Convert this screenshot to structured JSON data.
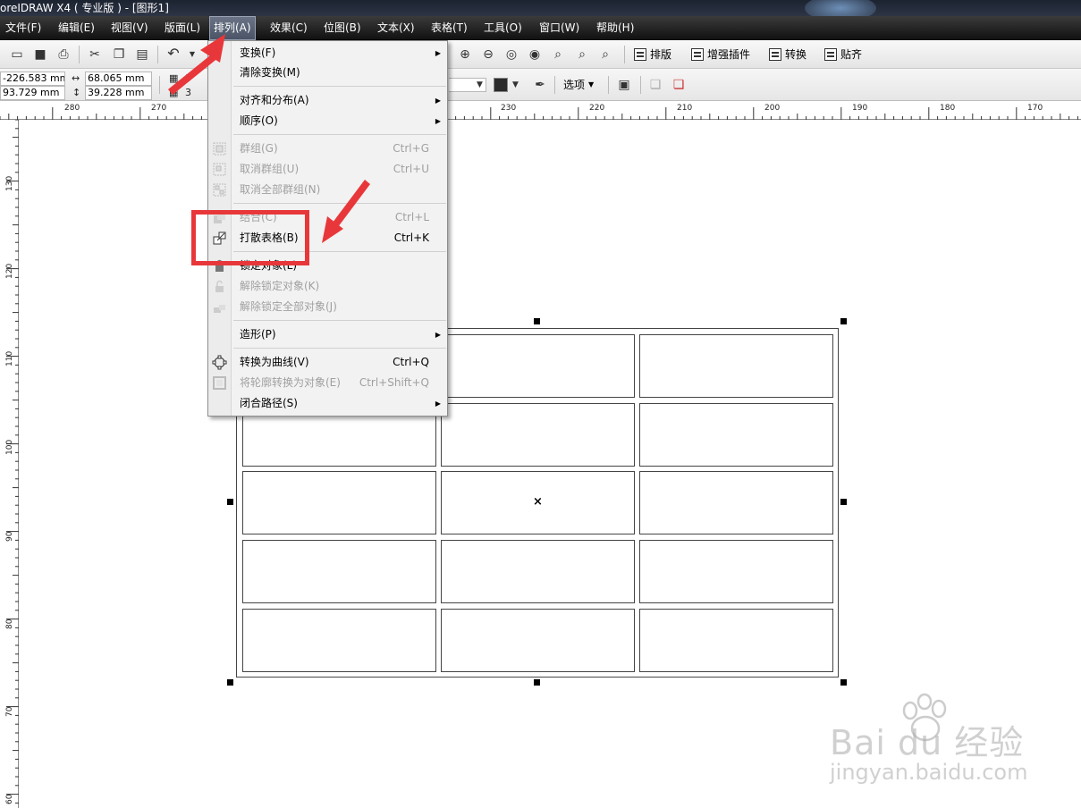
{
  "window": {
    "title": "oreIDRAW X4 ( 专业版 ) - [图形1]"
  },
  "menubar": {
    "items": [
      {
        "label": "文件(F)"
      },
      {
        "label": "编辑(E)"
      },
      {
        "label": "视图(V)"
      },
      {
        "label": "版面(L)"
      },
      {
        "label": "排列(A)"
      },
      {
        "label": "效果(C)"
      },
      {
        "label": "位图(B)"
      },
      {
        "label": "文本(X)"
      },
      {
        "label": "表格(T)"
      },
      {
        "label": "工具(O)"
      },
      {
        "label": "窗口(W)"
      },
      {
        "label": "帮助(H)"
      }
    ]
  },
  "toolbar": {
    "buttons": [
      {
        "label": "排版",
        "icon": "layout-icon"
      },
      {
        "label": "增强插件",
        "icon": "plugin-icon"
      },
      {
        "label": "转换",
        "icon": "convert-icon"
      },
      {
        "label": "贴齐",
        "icon": "snap-icon"
      }
    ]
  },
  "propertybar": {
    "x": "-226.583 mm",
    "y": "93.729 mm",
    "width": "68.065 mm",
    "height": "39.228 mm",
    "cols": "3",
    "rows": "3",
    "options_label": "选项",
    "outline_color": "#2b2b2b"
  },
  "ruler": {
    "top_labels": [
      "280",
      "270",
      "230",
      "220",
      "210",
      "200",
      "190",
      "180",
      "170"
    ],
    "left_labels": [
      "130",
      "120",
      "110",
      "100",
      "90",
      "80",
      "70",
      "60"
    ]
  },
  "table": {
    "rows": 5,
    "cols": 3
  },
  "menu": {
    "items": [
      {
        "label": "变换(F)",
        "shortcut": "",
        "submenu": true,
        "disabled": false,
        "icon": ""
      },
      {
        "label": "清除变换(M)",
        "shortcut": "",
        "submenu": false,
        "disabled": false,
        "icon": ""
      },
      {
        "label": "对齐和分布(A)",
        "shortcut": "",
        "submenu": true,
        "disabled": false,
        "icon": ""
      },
      {
        "label": "顺序(O)",
        "shortcut": "",
        "submenu": true,
        "disabled": false,
        "icon": ""
      },
      {
        "label": "群组(G)",
        "shortcut": "Ctrl+G",
        "submenu": false,
        "disabled": true,
        "icon": "group-icon"
      },
      {
        "label": "取消群组(U)",
        "shortcut": "Ctrl+U",
        "submenu": false,
        "disabled": true,
        "icon": "ungroup-icon"
      },
      {
        "label": "取消全部群组(N)",
        "shortcut": "",
        "submenu": false,
        "disabled": true,
        "icon": "ungroup-all-icon"
      },
      {
        "label": "结合(C)",
        "shortcut": "Ctrl+L",
        "submenu": false,
        "disabled": true,
        "icon": "combine-icon"
      },
      {
        "label": "打散表格(B)",
        "shortcut": "Ctrl+K",
        "submenu": false,
        "disabled": false,
        "icon": "break-apart-icon"
      },
      {
        "label": "锁定对象(L)",
        "shortcut": "",
        "submenu": false,
        "disabled": false,
        "icon": "lock-icon"
      },
      {
        "label": "解除锁定对象(K)",
        "shortcut": "",
        "submenu": false,
        "disabled": true,
        "icon": "unlock-icon"
      },
      {
        "label": "解除锁定全部对象(J)",
        "shortcut": "",
        "submenu": false,
        "disabled": true,
        "icon": "unlock-all-icon"
      },
      {
        "label": "造形(P)",
        "shortcut": "",
        "submenu": true,
        "disabled": false,
        "icon": ""
      },
      {
        "label": "转换为曲线(V)",
        "shortcut": "Ctrl+Q",
        "submenu": false,
        "disabled": false,
        "icon": "curve-icon"
      },
      {
        "label": "将轮廓转换为对象(E)",
        "shortcut": "Ctrl+Shift+Q",
        "submenu": false,
        "disabled": true,
        "icon": "outline-icon"
      },
      {
        "label": "闭合路径(S)",
        "shortcut": "",
        "submenu": true,
        "disabled": false,
        "icon": ""
      }
    ]
  },
  "watermark": {
    "brand": "Bai du 经验",
    "url": "jingyan.baidu.com"
  },
  "colors": {
    "highlight": "#e8373a",
    "menubar": "#1a1a1a"
  }
}
